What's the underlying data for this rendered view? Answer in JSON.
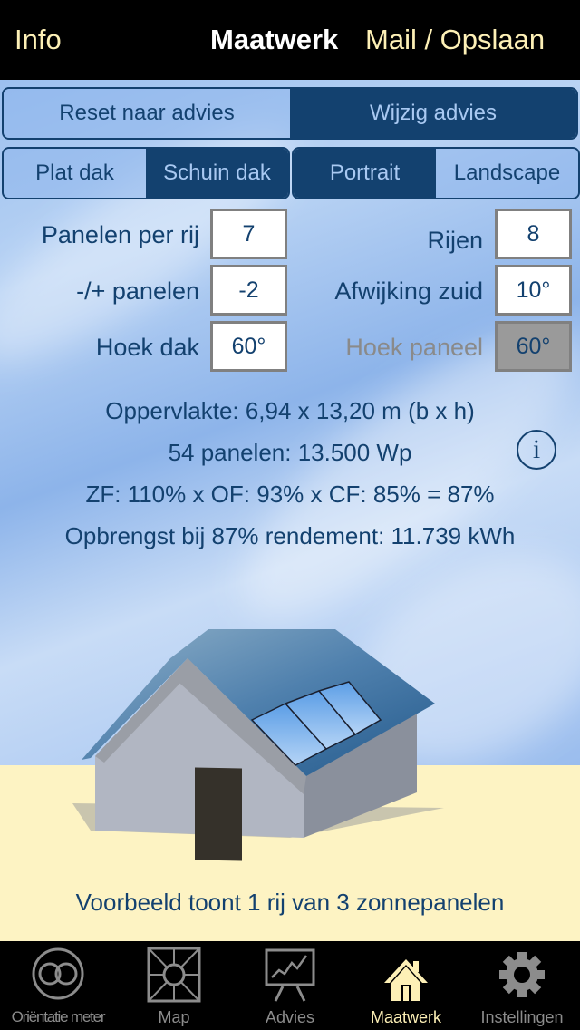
{
  "navbar": {
    "left_label": "Info",
    "title": "Maatwerk",
    "right_label": "Mail / Opslaan"
  },
  "advice_toggle": {
    "options": [
      {
        "label": "Reset naar advies",
        "selected": false
      },
      {
        "label": "Wijzig advies",
        "selected": true
      }
    ]
  },
  "roof_type": {
    "options": [
      {
        "label": "Plat dak",
        "selected": false
      },
      {
        "label": "Schuin dak",
        "selected": true
      }
    ]
  },
  "orientation": {
    "options": [
      {
        "label": "Portrait",
        "selected": true
      },
      {
        "label": "Landscape",
        "selected": false
      }
    ]
  },
  "fields": {
    "panels_per_row": {
      "label": "Panelen per rij",
      "value": "7"
    },
    "rows": {
      "label": "Rijen",
      "value": "8"
    },
    "panel_adjust": {
      "label": "-/+ panelen",
      "value": "-2"
    },
    "south_deviation": {
      "label": "Afwijking zuid",
      "value": "10°"
    },
    "roof_angle": {
      "label": "Hoek dak",
      "value": "60°"
    },
    "panel_angle": {
      "label": "Hoek paneel",
      "value": "60°",
      "disabled": true
    }
  },
  "results": {
    "area": "Oppervlakte: 6,94 x 13,20 m (b x h)",
    "panels": "54 panelen: 13.500 Wp",
    "factors": "ZF: 110% x OF: 93% x CF: 85% = 87%",
    "yield": "Opbrengst bij 87% rendement: 11.739 kWh"
  },
  "info_button": {
    "icon": "info-icon",
    "glyph": "i"
  },
  "illustration": {
    "caption": "Voorbeeld toont 1 rij van 3 zonnepanelen",
    "panel_count": 3
  },
  "tabbar": {
    "items": [
      {
        "label": "Oriëntatie meter",
        "icon": "orientation-meter-icon",
        "active": false
      },
      {
        "label": "Map",
        "icon": "map-icon",
        "active": false
      },
      {
        "label": "Advies",
        "icon": "chart-easel-icon",
        "active": false
      },
      {
        "label": "Maatwerk",
        "icon": "house-icon",
        "active": true
      },
      {
        "label": "Instellingen",
        "icon": "gear-icon",
        "active": false
      }
    ]
  },
  "colors": {
    "accent_dark_blue": "#13416f",
    "nav_yellow": "#fdf0b6",
    "sand": "#fdf3c3"
  }
}
